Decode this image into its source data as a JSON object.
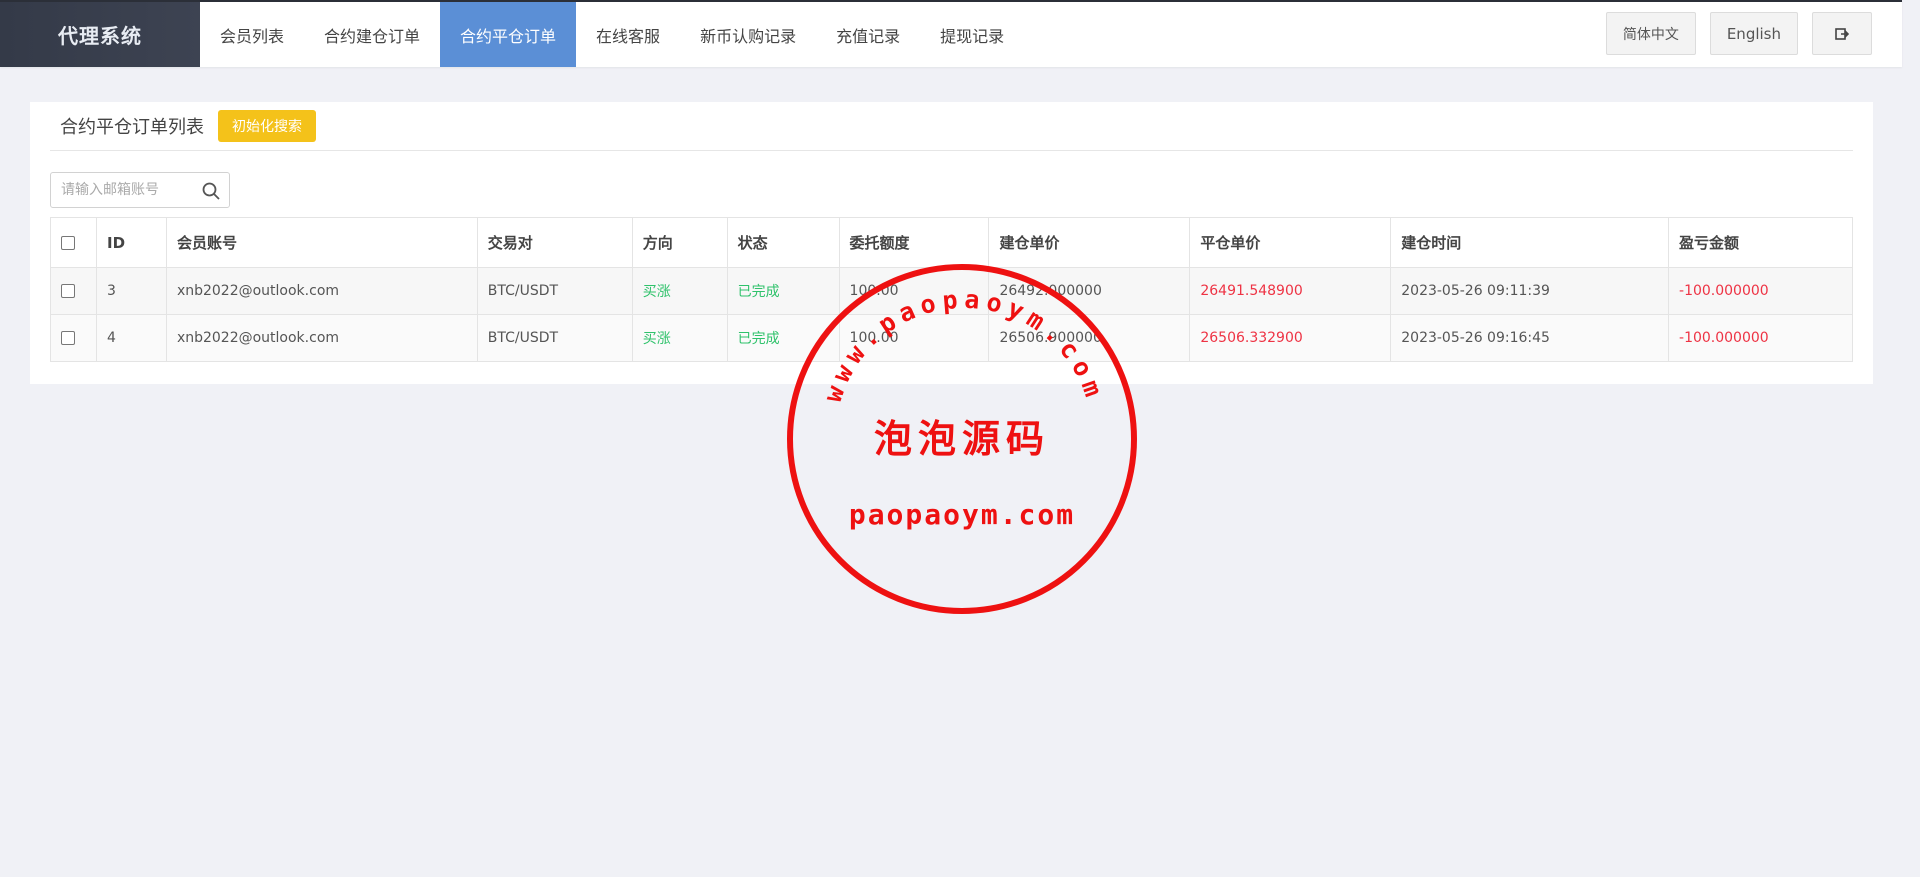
{
  "app": {
    "title": "代理系统"
  },
  "nav": {
    "items": [
      {
        "label": "会员列表"
      },
      {
        "label": "合约建仓订单"
      },
      {
        "label": "合约平仓订单",
        "active": true
      },
      {
        "label": "在线客服"
      },
      {
        "label": "新币认购记录"
      },
      {
        "label": "充值记录"
      },
      {
        "label": "提现记录"
      }
    ]
  },
  "header_tools": {
    "lang_zh": "简体中文",
    "lang_en": "English",
    "logout_icon": "logout-icon"
  },
  "panel": {
    "title": "合约平仓订单列表",
    "reset_label": "初始化搜索"
  },
  "search": {
    "placeholder": "请输入邮箱账号",
    "value": ""
  },
  "table": {
    "columns": [
      "ID",
      "会员账号",
      "交易对",
      "方向",
      "状态",
      "委托额度",
      "建仓单价",
      "平仓单价",
      "建仓时间",
      "盈亏金额"
    ],
    "rows": [
      {
        "id": "3",
        "account": "xnb2022@outlook.com",
        "pair": "BTC/USDT",
        "direction": "买涨",
        "status": "已完成",
        "amount": "100.00",
        "open_price": "26492.000000",
        "close_price": "26491.548900",
        "open_time": "2023-05-26 09:11:39",
        "pnl": "-100.000000"
      },
      {
        "id": "4",
        "account": "xnb2022@outlook.com",
        "pair": "BTC/USDT",
        "direction": "买涨",
        "status": "已完成",
        "amount": "100.00",
        "open_price": "26506.900000",
        "close_price": "26506.332900",
        "open_time": "2023-05-26 09:16:45",
        "pnl": "-100.000000"
      }
    ]
  },
  "watermark": {
    "top_text": "www.paopaoym.com",
    "center_text": "泡泡源码",
    "bottom_text": "paopaoym.com"
  },
  "colors": {
    "accent": "#5b8fd6",
    "logo_bg": "#343a48",
    "reset_btn": "#f4c21a",
    "positive": "#2fc26b",
    "negative": "#ee3344",
    "stamp": "#ee1111"
  }
}
